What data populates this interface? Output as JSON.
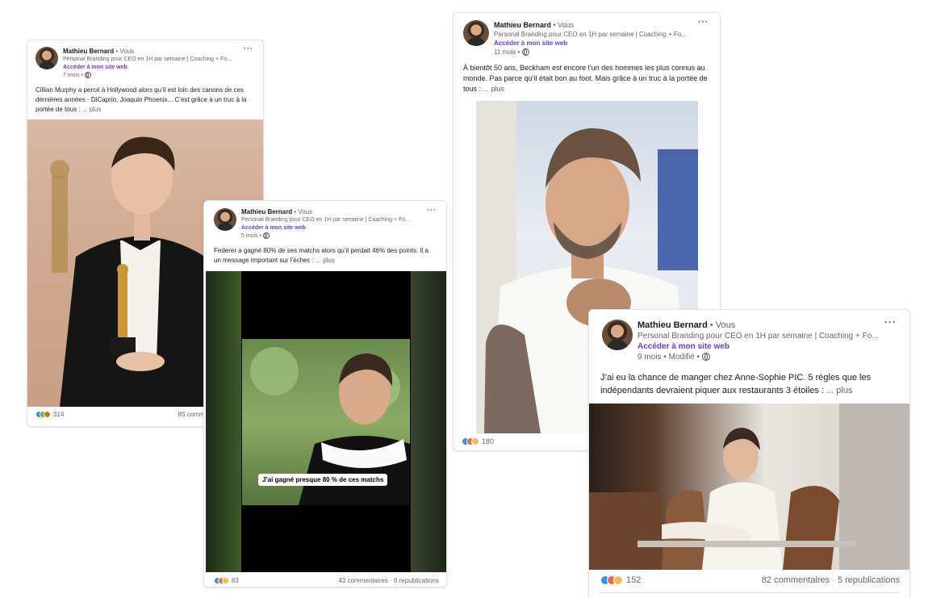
{
  "cards": [
    {
      "author": "Mathieu Bernard",
      "you": "• Vous",
      "subtitle": "Personal Branding pour CEO en 1H par semaine | Coaching + Fo...",
      "link": "Accéder à mon site web",
      "time": "7 mois •",
      "text": "Cillian Murphy a percé à Hollywood alors qu’il est loin des canons de ces dernières années - DiCaprio, Joaquin Phoenix... C’est grâce à un truc à la portée de tous :",
      "more": "... plus",
      "reactions": "314",
      "comments": "85 commentaires"
    },
    {
      "author": "Mathieu Bernard",
      "you": "• Vous",
      "subtitle": "Personal Branding pour CEO en 1H par semaine | Coaching + Fo...",
      "link": "Accéder à mon site web",
      "time": "5 mois •",
      "text": "Federer a gagné 80% de ses matchs alors qu’il perdait 46% des points. Il a un message important sur l’échec :",
      "more": "... plus",
      "caption": "J’ai gagné presque 80 % de ces matchs",
      "reactions": "83",
      "comments": "43 commentaires · 6 republications"
    },
    {
      "author": "Mathieu Bernard",
      "you": "• Vous",
      "subtitle": "Personal Branding pour CEO en 1H par semaine | Coaching + Fo...",
      "link": "Accéder à mon site web",
      "time": "11 mois •",
      "text": "À bientôt 50 ans, Beckham est encore l’un des hommes les plus connus au monde. Pas parce qu’il était bon au foot. Mais grâce à un truc à la portée de tous :",
      "more": "... plus",
      "reactions": "180"
    },
    {
      "author": "Mathieu Bernard",
      "you": "• Vous",
      "subtitle": "Personal Branding pour CEO en 1H par semaine | Coaching + Fo...",
      "link": "Accéder à mon site web",
      "time": "9 mois • Modifié •",
      "text": "J’ai eu la chance de manger chez Anne-Sophie PIC. 5 règles que les indépendants devraient piquer aux restaurants 3 étoiles :",
      "more": "... plus",
      "reactions": "152",
      "comments": "82 commentaires · 5 republications"
    }
  ],
  "menu_glyph": "···"
}
